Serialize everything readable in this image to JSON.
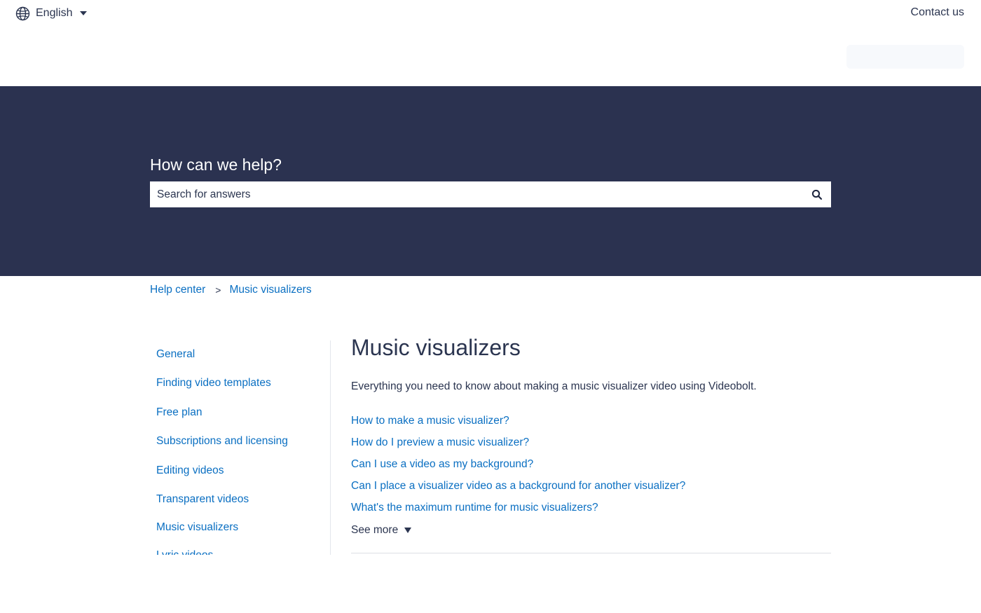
{
  "header": {
    "language": "English",
    "contact_label": "Contact us"
  },
  "hero": {
    "title": "How can we help?",
    "search_placeholder": "Search for answers"
  },
  "breadcrumb": {
    "items": [
      "Help center",
      "Music visualizers"
    ],
    "separator": ">"
  },
  "sidebar": {
    "items": [
      {
        "label": "General"
      },
      {
        "label": "Finding video templates"
      },
      {
        "label": "Free plan"
      },
      {
        "label": "Subscriptions and licensing"
      },
      {
        "label": "Editing videos"
      },
      {
        "label": "Transparent videos"
      },
      {
        "label": "Music visualizers"
      },
      {
        "label": "Lyric videos"
      }
    ]
  },
  "main": {
    "title": "Music visualizers",
    "description": "Everything you need to know about making a music visualizer video using Videobolt.",
    "articles": [
      "How to make a music visualizer?",
      "How do I preview a music visualizer?",
      "Can I use a video as my background?",
      "Can I place a visualizer video as a background for another visualizer?",
      "What's the maximum runtime for music visualizers?"
    ],
    "see_more_label": "See more"
  },
  "colors": {
    "hero_background": "#2b3250",
    "link": "#0a6fc2",
    "text": "#2b3550"
  }
}
